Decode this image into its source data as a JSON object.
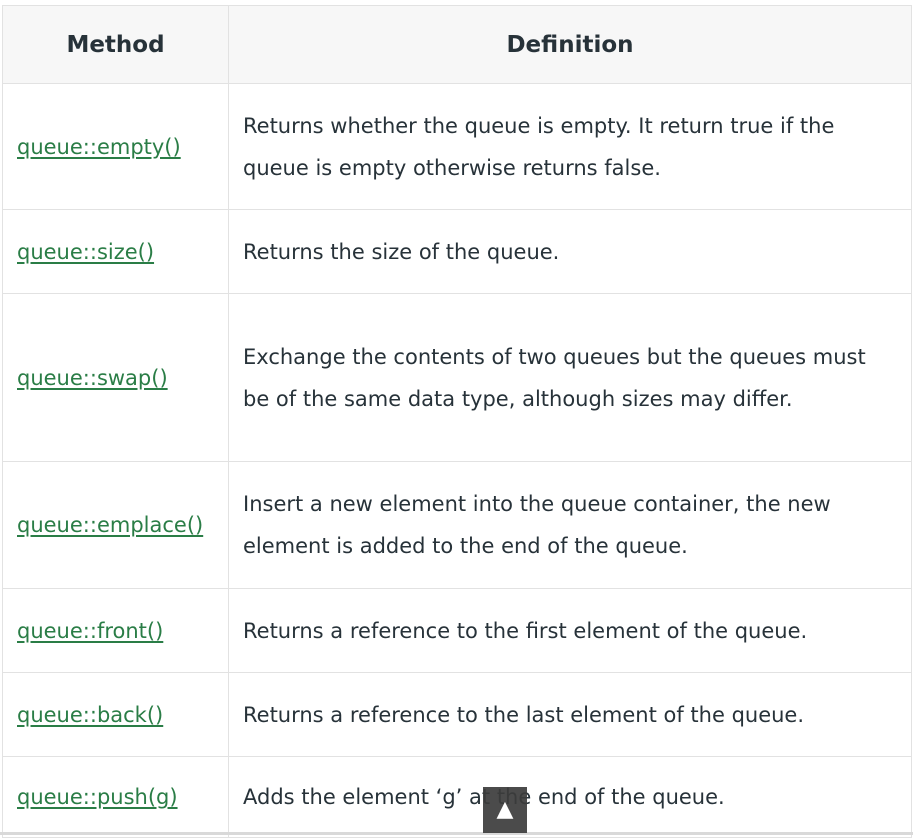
{
  "table": {
    "headers": {
      "method": "Method",
      "definition": "Definition"
    },
    "rows": [
      {
        "method": "queue::empty()",
        "definition": "Returns whether the queue is empty. It return true if the queue is empty otherwise returns false."
      },
      {
        "method": "queue::size()",
        "definition": "Returns the size of the queue."
      },
      {
        "method": "queue::swap()",
        "definition": "Exchange the contents of two queues but the queues must be of the same data type, although sizes may differ."
      },
      {
        "method": "queue::emplace()",
        "definition": "Insert a new element into the queue container, the new element is added to the end of the queue."
      },
      {
        "method": "queue::front()",
        "definition": "Returns a reference to the first element of the queue."
      },
      {
        "method": "queue::back()",
        "definition": "Returns a reference to the last element of the queue."
      },
      {
        "method": "queue::push(g) ",
        "definition": "Adds the element ‘g’ at the end of the queue."
      }
    ]
  },
  "scroll_to_top": {
    "glyph": "▲",
    "icon": "arrow-up-icon"
  },
  "colors": {
    "link": "#2a7d46",
    "text": "#273239",
    "header_bg": "#f7f7f7",
    "border": "#e2e2e2"
  }
}
